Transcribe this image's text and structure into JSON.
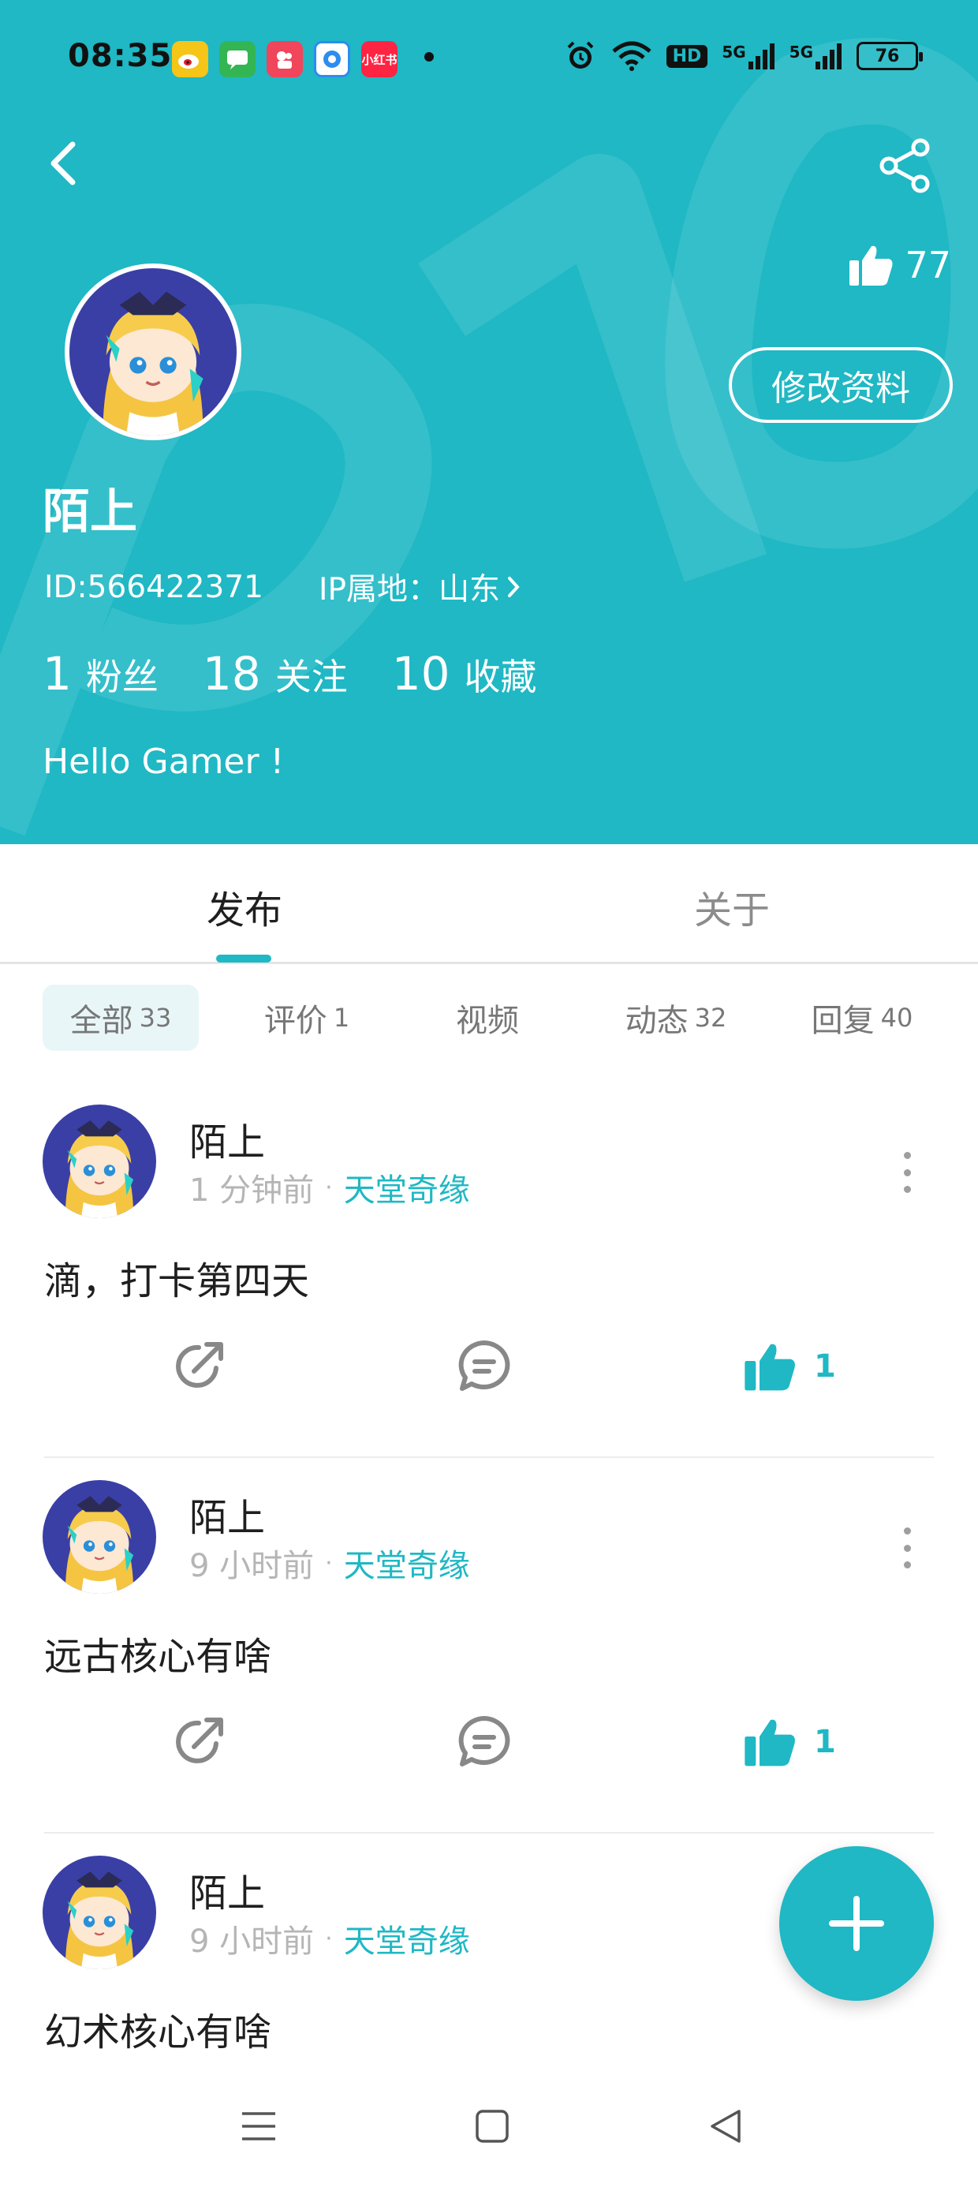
{
  "status_bar": {
    "time": "08:35",
    "app_icons": [
      {
        "name": "weibo-app-icon",
        "color": "#f5c518",
        "label": "微"
      },
      {
        "name": "messages-app-icon",
        "color": "#34b554",
        "label": ""
      },
      {
        "name": "camera-app-icon",
        "color": "#f0455a",
        "label": ""
      },
      {
        "name": "browser-app-icon",
        "color": "#2d8cf0",
        "label": ""
      },
      {
        "name": "xiaohongshu-app-icon",
        "color": "#ff2442",
        "label": "小红书"
      }
    ],
    "network_hd": "HD",
    "network_5g": "5G",
    "battery": "76"
  },
  "profile": {
    "likes": "77",
    "edit_label": "修改资料",
    "username": "陌上",
    "id_text": "ID:566422371",
    "ip_text": "IP属地：山东",
    "stats": [
      {
        "num": "1",
        "label": "粉丝"
      },
      {
        "num": "18",
        "label": "关注"
      },
      {
        "num": "10",
        "label": "收藏"
      }
    ],
    "bio": "Hello Gamer !"
  },
  "tabs": {
    "publish": "发布",
    "about": "关于"
  },
  "filters": [
    {
      "label": "全部",
      "count": "33"
    },
    {
      "label": "评价",
      "count": "1"
    },
    {
      "label": "视频",
      "count": ""
    },
    {
      "label": "动态",
      "count": "32"
    },
    {
      "label": "回复",
      "count": "40"
    }
  ],
  "posts": [
    {
      "author": "陌上",
      "time": "1 分钟前",
      "sep": "·",
      "game": "天堂奇缘",
      "text": "滴，打卡第四天",
      "likes": "1"
    },
    {
      "author": "陌上",
      "time": "9 小时前",
      "sep": "·",
      "game": "天堂奇缘",
      "text": "远古核心有啥",
      "likes": "1"
    },
    {
      "author": "陌上",
      "time": "9 小时前",
      "sep": "·",
      "game": "天堂奇缘",
      "text": "幻术核心有啥",
      "likes": ""
    }
  ],
  "colors": {
    "accent": "#1fb8c4",
    "header_bg": "#1fb8c4",
    "chip_active_bg": "#e9f6f8"
  }
}
